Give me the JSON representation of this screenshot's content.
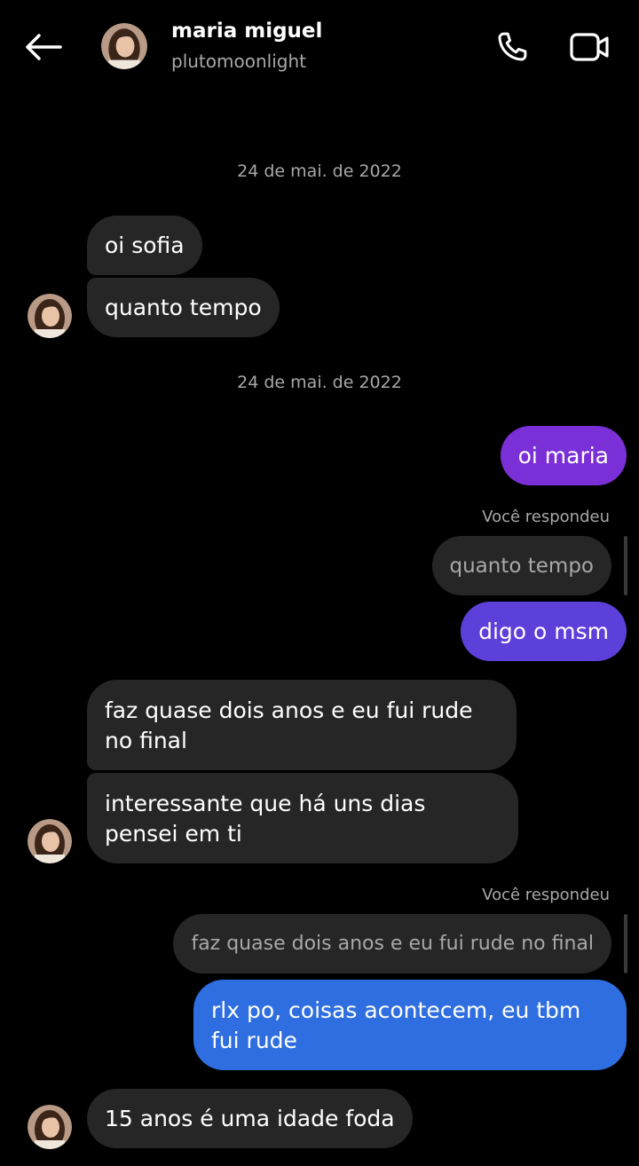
{
  "header": {
    "name": "maria miguel",
    "username": "plutomoonlight",
    "icons": {
      "back": "back-arrow-icon",
      "call": "phone-icon",
      "video": "video-camera-icon"
    }
  },
  "dates": [
    "24 de mai. de 2022",
    "24 de mai. de 2022"
  ],
  "messages": {
    "m1": "oi sofia",
    "m2": "quanto tempo",
    "m3": "oi maria",
    "m4_label": "Você respondeu",
    "m4_quote": "quanto tempo",
    "m4": "digo o msm",
    "m5": "faz quase dois anos e eu fui rude no final",
    "m6": "interessante que há uns dias pensei em ti",
    "m7_label": "Você respondeu",
    "m7_quote": "faz quase dois anos e eu fui rude no final",
    "m7": "rlx po, coisas acontecem, eu tbm fui rude",
    "m8": "15 anos é uma idade foda"
  },
  "colors": {
    "background": "#000000",
    "incoming_bubble": "#262626",
    "outgoing_purple": "#7b2fd6",
    "outgoing_indigo": "#5d3fd9",
    "outgoing_blue": "#2f6ee0",
    "secondary_text": "#a8a8a8"
  }
}
